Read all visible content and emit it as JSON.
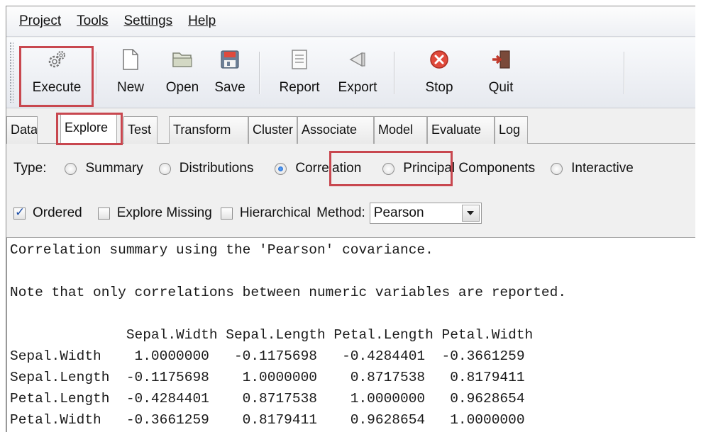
{
  "menu": [
    {
      "label": "Project"
    },
    {
      "label": "Tools"
    },
    {
      "label": "Settings"
    },
    {
      "label": "Help"
    }
  ],
  "toolbar": {
    "execute": "Execute",
    "new": "New",
    "open": "Open",
    "save": "Save",
    "report": "Report",
    "export": "Export",
    "stop": "Stop",
    "quit": "Quit"
  },
  "tabs": [
    "Data",
    "Explore",
    "Test",
    "Transform",
    "Cluster",
    "Associate",
    "Model",
    "Evaluate",
    "Log"
  ],
  "active_tab": "Explore",
  "type_row": {
    "label": "Type:",
    "options": [
      "Summary",
      "Distributions",
      "Correlation",
      "Principal Components",
      "Interactive"
    ],
    "selected": "Correlation"
  },
  "options_row": {
    "ordered": {
      "label": "Ordered",
      "checked": true
    },
    "explore_missing": {
      "label": "Explore Missing",
      "checked": false
    },
    "hierarchical": {
      "label": "Hierarchical",
      "checked": false
    },
    "method_label": "Method:",
    "method_value": "Pearson"
  },
  "output": {
    "line1": "Correlation summary using the 'Pearson' covariance.",
    "line2": "Note that only correlations between numeric variables are reported.",
    "header": "              Sepal.Width Sepal.Length Petal.Length Petal.Width",
    "rows": [
      "Sepal.Width    1.0000000   -0.1175698   -0.4284401  -0.3661259",
      "Sepal.Length  -0.1175698    1.0000000    0.8717538   0.8179411",
      "Petal.Length  -0.4284401    0.8717538    1.0000000   0.9628654",
      "Petal.Width   -0.3661259    0.8179411    0.9628654   1.0000000"
    ]
  },
  "colors": {
    "highlight": "#c8474f",
    "stop_icon": "#e04a3c",
    "quit_icon": "#c0392b"
  }
}
